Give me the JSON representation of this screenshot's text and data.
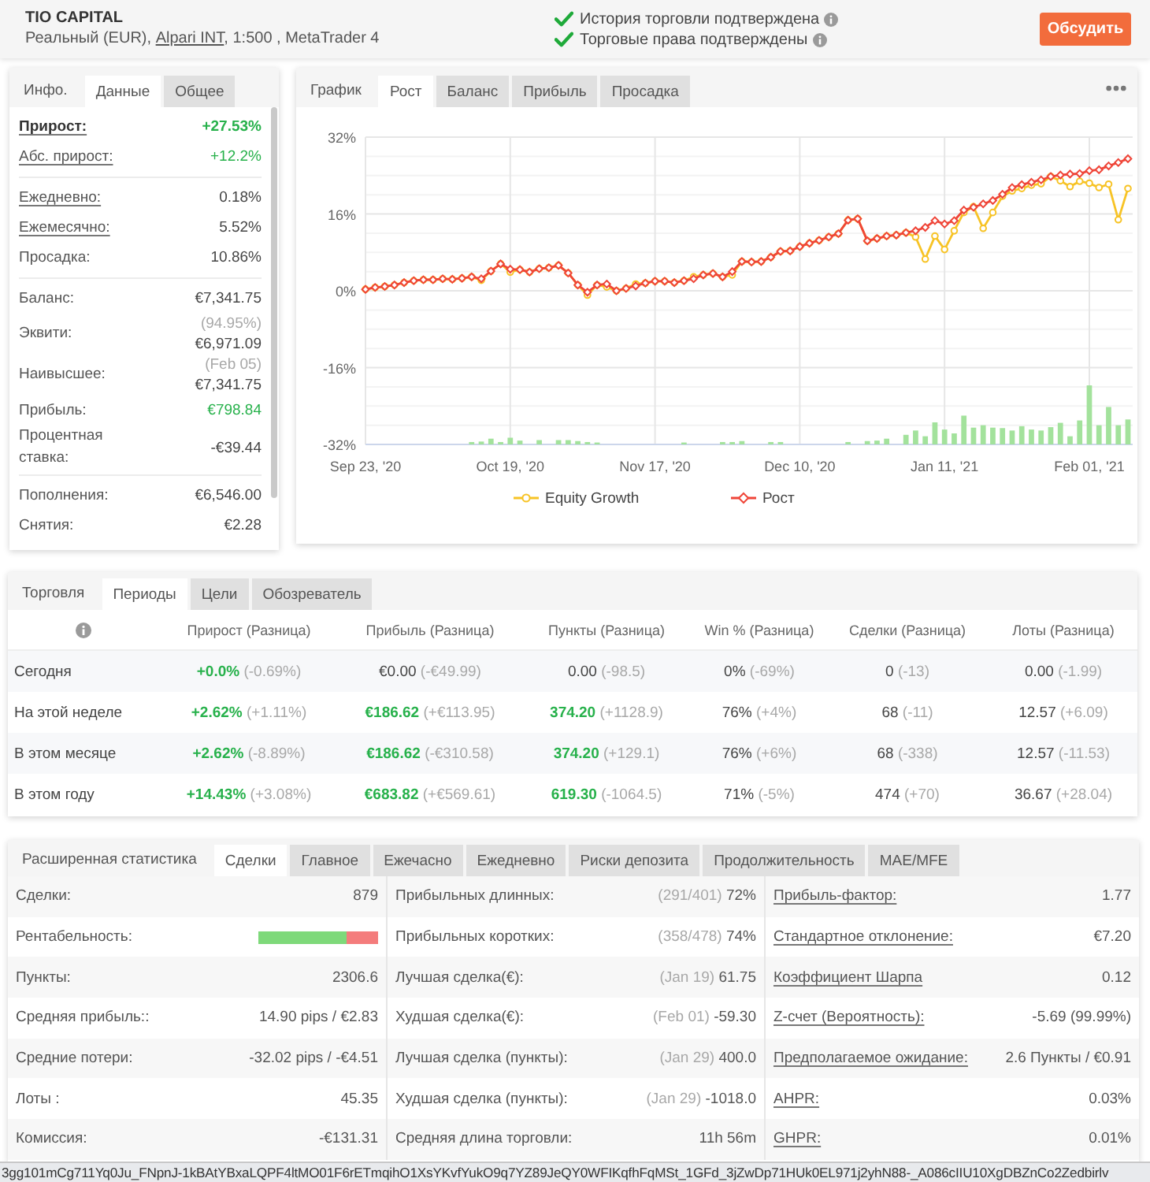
{
  "header": {
    "title": "TIO CAPITAL",
    "account": {
      "prefix": "Реальный (EUR),",
      "broker": "Alpari INT",
      "suffix": ", 1:500 , MetaTrader 4"
    },
    "verifications": [
      {
        "text": "История торговли подтверждена",
        "verified": true
      },
      {
        "text": "Торговые права подтверждены",
        "verified": true
      }
    ],
    "discuss_button": "Обсудить"
  },
  "info_panel": {
    "title": "Инфо.",
    "tabs": [
      {
        "label": "Данные",
        "selected": true
      },
      {
        "label": "Общее",
        "selected": false
      }
    ],
    "groups": [
      [
        {
          "label": "Прирост:",
          "value": "+27.53%",
          "bold": true,
          "underlined": true,
          "positive": true
        },
        {
          "label": "Абс. прирост:",
          "value": "+12.2%",
          "bold": false,
          "underlined": true,
          "positive": true
        }
      ],
      [
        {
          "label": "Ежедневно:",
          "value": "0.18%",
          "bold": false,
          "underlined": true,
          "positive": false
        },
        {
          "label": "Ежемесячно:",
          "value": "5.52%",
          "bold": false,
          "underlined": true,
          "positive": false
        },
        {
          "label": "Просадка:",
          "value": "10.86%",
          "bold": false,
          "underlined": false,
          "positive": false
        }
      ],
      [
        {
          "label": "Баланс:",
          "value": "€7,341.75",
          "bold": false,
          "underlined": false,
          "positive": false
        },
        {
          "label": "Эквити:",
          "note": "(94.95%)",
          "value": "€6,971.09",
          "bold": false,
          "underlined": false,
          "positive": false
        },
        {
          "label": "Наивысшее:",
          "note": "(Feb 05)",
          "value": "€7,341.75",
          "bold": false,
          "underlined": false,
          "positive": false
        },
        {
          "label": "Прибыль:",
          "value": "€798.84",
          "bold": false,
          "underlined": false,
          "positive": true
        },
        {
          "label": "Процентная ставка:",
          "value": "-€39.44",
          "bold": false,
          "underlined": false,
          "positive": false
        }
      ],
      [
        {
          "label": "Пополнения:",
          "value": "€6,546.00",
          "bold": false,
          "underlined": false,
          "positive": false
        },
        {
          "label": "Снятия:",
          "value": "€2.28",
          "bold": false,
          "underlined": false,
          "positive": false
        }
      ]
    ]
  },
  "chart_panel": {
    "title": "График",
    "tabs": [
      {
        "label": "Рост",
        "selected": true
      },
      {
        "label": "Баланс",
        "selected": false
      },
      {
        "label": "Прибыль",
        "selected": false
      },
      {
        "label": "Просадка",
        "selected": false
      }
    ],
    "chart_data": {
      "type": "line",
      "categories": [
        "Sep 23, '20",
        null,
        null,
        null,
        null,
        null,
        null,
        null,
        null,
        null,
        null,
        null,
        null,
        null,
        null,
        "Oct 19, '20",
        null,
        null,
        null,
        null,
        null,
        null,
        null,
        null,
        null,
        null,
        null,
        null,
        null,
        null,
        "Nov 17, '20",
        null,
        null,
        null,
        null,
        null,
        null,
        null,
        null,
        null,
        null,
        null,
        null,
        null,
        null,
        "Dec 10, '20",
        null,
        null,
        null,
        null,
        null,
        null,
        null,
        null,
        null,
        null,
        null,
        null,
        null,
        null,
        "Jan 11, '21",
        null,
        null,
        null,
        null,
        null,
        null,
        null,
        null,
        null,
        null,
        null,
        null,
        null,
        null,
        "Feb 01, '21",
        null,
        null,
        null,
        null
      ],
      "ylim": [
        -32,
        32
      ],
      "yticks": [
        {
          "value": -32,
          "label": "-32%"
        },
        {
          "value": -16,
          "label": "-16%"
        },
        {
          "value": 0,
          "label": "0%"
        },
        {
          "value": 16,
          "label": "16%"
        },
        {
          "value": 32,
          "label": "32%"
        }
      ],
      "grid": true,
      "legend": "bottom",
      "series": [
        {
          "name": "Equity Growth",
          "marker": "circle",
          "color": "#f7c325",
          "values": [
            0.3,
            0.7,
            0.9,
            1.2,
            1.7,
            2.1,
            2.3,
            2.3,
            2.5,
            2.4,
            2.6,
            2.9,
            2.2,
            4.1,
            5.6,
            3.9,
            4.4,
            3.9,
            4.6,
            4.8,
            5.3,
            3.7,
            1.2,
            -0.9,
            1.2,
            0.8,
            0.0,
            0.5,
            1.4,
            1.6,
            2.0,
            2.0,
            1.7,
            2.1,
            2.9,
            3.3,
            3.6,
            2.9,
            3.3,
            6.1,
            6.0,
            6.1,
            7.0,
            8.2,
            8.3,
            9.2,
            9.9,
            10.5,
            11.2,
            11.9,
            14.7,
            15.0,
            10.4,
            10.9,
            11.4,
            11.6,
            12.1,
            11.2,
            6.6,
            11.4,
            8.6,
            12.5,
            16.3,
            17.5,
            13.0,
            16.3,
            19.7,
            20.8,
            21.3,
            22.0,
            22.3,
            23.8,
            22.9,
            21.7,
            22.8,
            22.4,
            21.5,
            22.2,
            14.8,
            21.3
          ]
        },
        {
          "name": "Рост",
          "marker": "diamond",
          "color": "#ef4538",
          "values": [
            0.3,
            0.7,
            0.9,
            1.2,
            1.7,
            2.1,
            2.3,
            2.3,
            2.5,
            2.4,
            2.6,
            2.9,
            2.5,
            4.1,
            5.6,
            4.5,
            4.4,
            3.9,
            4.6,
            4.8,
            5.3,
            3.7,
            1.2,
            -0.3,
            1.2,
            1.4,
            0.0,
            0.5,
            1.0,
            1.6,
            2.0,
            2.0,
            1.7,
            2.1,
            2.5,
            3.3,
            3.6,
            2.9,
            4.0,
            6.1,
            6.0,
            6.1,
            7.0,
            8.2,
            8.3,
            9.2,
            9.9,
            10.5,
            11.2,
            11.9,
            14.7,
            15.0,
            10.4,
            10.9,
            11.4,
            11.6,
            12.1,
            12.5,
            13.2,
            14.6,
            13.9,
            14.6,
            16.8,
            17.4,
            18.1,
            18.8,
            20.1,
            21.5,
            22.1,
            22.6,
            23.1,
            23.8,
            24.1,
            24.3,
            24.4,
            25.0,
            25.2,
            26.0,
            26.7,
            27.5
          ]
        }
      ]
    }
  },
  "periods_panel": {
    "title": "Торговля",
    "tabs": [
      {
        "label": "Периоды",
        "selected": true
      },
      {
        "label": "Цели",
        "selected": false
      },
      {
        "label": "Обозреватель",
        "selected": false
      }
    ],
    "table": {
      "columns": [
        "Прирост (Разница)",
        "Прибыль (Разница)",
        "Пункты (Разница)",
        "Win % (Разница)",
        "Сделки (Разница)",
        "Лоты (Разница)"
      ],
      "rows": [
        {
          "label": "Сегодня",
          "cells": [
            {
              "value": "+0.0%",
              "diff": "(-0.69%)",
              "positive": true
            },
            {
              "value": "€0.00",
              "diff": "(-€49.99)",
              "positive": false
            },
            {
              "value": "0.00",
              "diff": "(-98.5)",
              "positive": false
            },
            {
              "value": "0%",
              "diff": "(-69%)",
              "positive": false
            },
            {
              "value": "0",
              "diff": "(-13)",
              "positive": false
            },
            {
              "value": "0.00",
              "diff": "(-1.99)",
              "positive": false
            }
          ]
        },
        {
          "label": "На этой неделе",
          "cells": [
            {
              "value": "+2.62%",
              "diff": "(+1.11%)",
              "positive": true
            },
            {
              "value": "€186.62",
              "diff": "(+€113.95)",
              "positive": true
            },
            {
              "value": "374.20",
              "diff": "(+1128.9)",
              "positive": true
            },
            {
              "value": "76%",
              "diff": "(+4%)",
              "positive": false
            },
            {
              "value": "68",
              "diff": "(-11)",
              "positive": false
            },
            {
              "value": "12.57",
              "diff": "(+6.09)",
              "positive": false
            }
          ]
        },
        {
          "label": "В этом месяце",
          "cells": [
            {
              "value": "+2.62%",
              "diff": "(-8.89%)",
              "positive": true
            },
            {
              "value": "€186.62",
              "diff": "(-€310.58)",
              "positive": true
            },
            {
              "value": "374.20",
              "diff": "(+129.1)",
              "positive": true
            },
            {
              "value": "76%",
              "diff": "(+6%)",
              "positive": false
            },
            {
              "value": "68",
              "diff": "(-338)",
              "positive": false
            },
            {
              "value": "12.57",
              "diff": "(-11.53)",
              "positive": false
            }
          ]
        },
        {
          "label": "В этом году",
          "cells": [
            {
              "value": "+14.43%",
              "diff": "(+3.08%)",
              "positive": true
            },
            {
              "value": "€683.82",
              "diff": "(+€569.61)",
              "positive": true
            },
            {
              "value": "619.30",
              "diff": "(-1064.5)",
              "positive": true
            },
            {
              "value": "71%",
              "diff": "(-5%)",
              "positive": false
            },
            {
              "value": "474",
              "diff": "(+70)",
              "positive": false
            },
            {
              "value": "36.67",
              "diff": "(+28.04)",
              "positive": false
            }
          ]
        }
      ]
    }
  },
  "stats_panel": {
    "title": "Расширенная статистика",
    "tabs": [
      {
        "label": "Сделки",
        "selected": true
      },
      {
        "label": "Главное",
        "selected": false
      },
      {
        "label": "Ежечасно",
        "selected": false
      },
      {
        "label": "Ежедневно",
        "selected": false
      },
      {
        "label": "Риски депозита",
        "selected": false
      },
      {
        "label": "Продолжительность",
        "selected": false
      },
      {
        "label": "MAE/MFE",
        "selected": false
      }
    ],
    "columns": [
      [
        {
          "kind": "text",
          "label": "Сделки:",
          "value": "879",
          "underlined": false
        },
        {
          "kind": "bar",
          "label": "Рентабельность:",
          "level": 0.74,
          "underlined": false
        },
        {
          "kind": "text",
          "label": "Пункты:",
          "value": "2306.6",
          "underlined": false
        },
        {
          "kind": "text",
          "label": "Средняя прибыль::",
          "value": "14.90 pips / €2.83",
          "underlined": false
        },
        {
          "kind": "text",
          "label": "Средние потери:",
          "value": "-32.02 pips / -€4.51",
          "underlined": false
        },
        {
          "kind": "text",
          "label": "Лоты :",
          "value": "45.35",
          "underlined": false
        },
        {
          "kind": "text",
          "label": "Комиссия:",
          "value": "-€131.31",
          "underlined": false
        }
      ],
      [
        {
          "kind": "text",
          "label": "Прибыльных длинных:",
          "note": "(291/401)",
          "value": "72%",
          "underlined": false
        },
        {
          "kind": "text",
          "label": "Прибыльных коротких:",
          "note": "(358/478)",
          "value": "74%",
          "underlined": false
        },
        {
          "kind": "text",
          "label": "Лучшая сделка(€):",
          "note": "(Jan 19)",
          "value": "61.75",
          "underlined": false
        },
        {
          "kind": "text",
          "label": "Худшая сделка(€):",
          "note": "(Feb 01)",
          "value": "-59.30",
          "underlined": false
        },
        {
          "kind": "text",
          "label": "Лучшая сделка (пункты):",
          "note": "(Jan 29)",
          "value": "400.0",
          "underlined": false
        },
        {
          "kind": "text",
          "label": "Худшая сделка (пункты):",
          "note": "(Jan 29)",
          "value": "-1018.0",
          "underlined": false
        },
        {
          "kind": "text",
          "label": "Средняя длина торговли:",
          "value": "11h 56m",
          "underlined": false
        }
      ],
      [
        {
          "kind": "text",
          "label": "Прибыль-фактор:",
          "value": "1.77",
          "underlined": true
        },
        {
          "kind": "text",
          "label": "Стандартное отклонение:",
          "value": "€7.20",
          "underlined": true
        },
        {
          "kind": "text",
          "label": "Коэффициент Шарпа",
          "value": "0.12",
          "underlined": true
        },
        {
          "kind": "text",
          "label": "Z-счет (Вероятность):",
          "value": "-5.69 (99.99%)",
          "underlined": true
        },
        {
          "kind": "text",
          "label": "Предполагаемое ожидание:",
          "value": "2.6 Пункты / €0.91",
          "underlined": true
        },
        {
          "kind": "text",
          "label": "AHPR:",
          "value": "0.03%",
          "underlined": true
        },
        {
          "kind": "text",
          "label": "GHPR:",
          "value": "0.01%",
          "underlined": true
        }
      ]
    ]
  },
  "status_bar": {
    "text": "3gg101mCg711Yq0Ju_FNpnJ-1kBAtYBxaLQPF4ltMO01F6rETmqihO1XsYKvfYukO9q7YZ89JeQY0WFIKqfhFqMSt_1GFd_3jZwDp71HUk0EL971j2yhN88-_A086cIIU10XgDBZnCo2Zedbirlv"
  }
}
